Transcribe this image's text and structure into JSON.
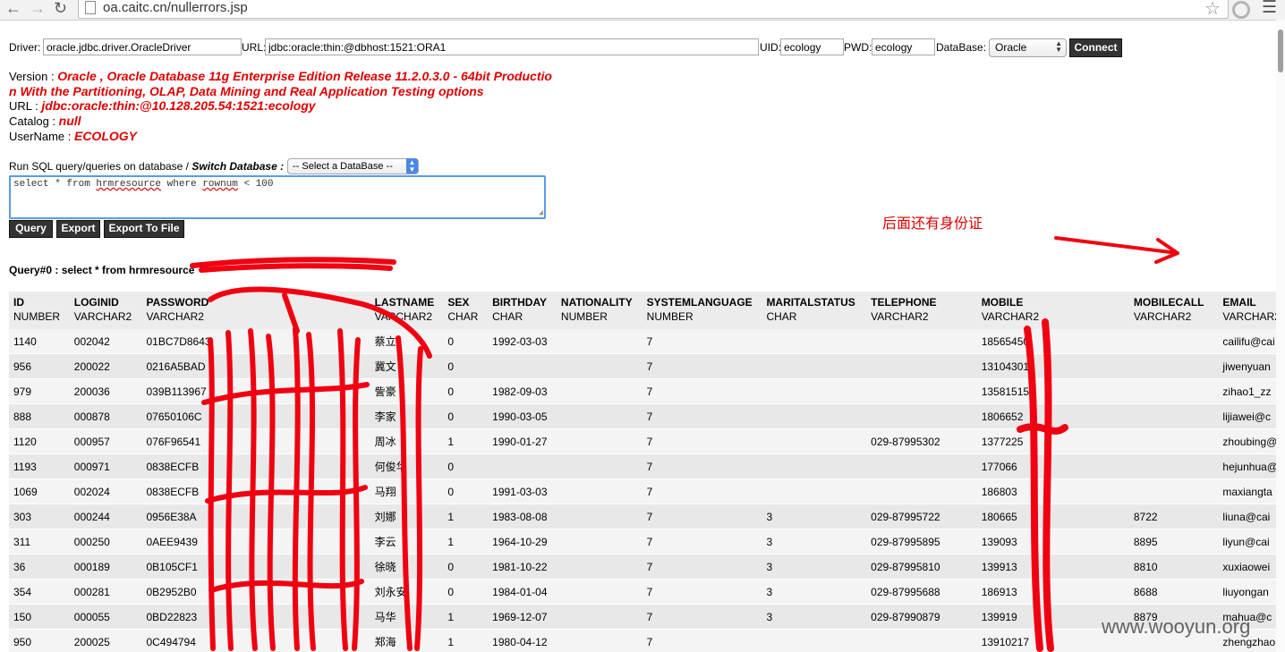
{
  "browser": {
    "url": "oa.caitc.cn/nullerrors.jsp"
  },
  "form": {
    "driver_label": "Driver:",
    "driver_value": "oracle.jdbc.driver.OracleDriver",
    "url_label": "URL:",
    "url_value": "jdbc:oracle:thin:@dbhost:1521:ORA1",
    "uid_label": "UID:",
    "uid_value": "ecology",
    "pwd_label": "PWD:",
    "pwd_value": "ecology",
    "database_label": "DataBase:",
    "database_value": "Oracle",
    "connect_label": "Connect"
  },
  "info": {
    "version_label": "Version :",
    "version_line1": "Oracle , Oracle Database 11g Enterprise Edition Release 11.2.0.3.0 - 64bit Productio",
    "version_line2": "n With the Partitioning, OLAP, Data Mining and Real Application Testing options",
    "url_label": "URL :",
    "url_value": "jdbc:oracle:thin:@10.128.205.54:1521:ecology",
    "catalog_label": "Catalog :",
    "catalog_value": "null",
    "username_label": "UserName :",
    "username_value": "ECOLOGY"
  },
  "query": {
    "run_label": "Run SQL query/queries on database /",
    "switch_label": "Switch Database :",
    "switch_value": "-- Select a DataBase --",
    "sql_before": "select * from ",
    "sql_table": "hrmresource",
    "sql_middle": " where ",
    "sql_rownum": "rownum",
    "sql_after": " < 100",
    "query_btn": "Query",
    "export_btn": "Export",
    "export_file_btn": "Export To File",
    "result_title": "Query#0 : select * from hrmresource"
  },
  "annotation": "后面还有身份证",
  "watermark": "www.wooyun.org",
  "table": {
    "columns": [
      {
        "name": "ID",
        "type": "NUMBER"
      },
      {
        "name": "LOGINID",
        "type": "VARCHAR2"
      },
      {
        "name": "PASSWORD",
        "type": "VARCHAR2"
      },
      {
        "name": "LASTNAME",
        "type": "VARCHAR2"
      },
      {
        "name": "SEX",
        "type": "CHAR"
      },
      {
        "name": "BIRTHDAY",
        "type": "CHAR"
      },
      {
        "name": "NATIONALITY",
        "type": "NUMBER"
      },
      {
        "name": "SYSTEMLANGUAGE",
        "type": "NUMBER"
      },
      {
        "name": "MARITALSTATUS",
        "type": "CHAR"
      },
      {
        "name": "TELEPHONE",
        "type": "VARCHAR2"
      },
      {
        "name": "MOBILE",
        "type": "VARCHAR2"
      },
      {
        "name": "MOBILECALL",
        "type": "VARCHAR2"
      },
      {
        "name": "EMAIL",
        "type": "VARCHAR2"
      }
    ],
    "rows": [
      [
        "1140",
        "002042",
        "01BC7D8643",
        "蔡立",
        "0",
        "1992-03-03",
        "",
        "7",
        "",
        "",
        "18565450",
        "",
        "cailifu@cai"
      ],
      [
        "956",
        "200022",
        "0216A5BAD",
        "冀文",
        "0",
        "",
        "",
        "7",
        "",
        "",
        "13104301",
        "",
        "jiwenyuan"
      ],
      [
        "979",
        "200036",
        "039B113967",
        "訾豪",
        "0",
        "1982-09-03",
        "",
        "7",
        "",
        "",
        "13581515",
        "",
        "zihao1_zz"
      ],
      [
        "888",
        "000878",
        "07650106C",
        "李家",
        "0",
        "1990-03-05",
        "",
        "7",
        "",
        "",
        "1806652",
        "",
        "lijiawei@c"
      ],
      [
        "1120",
        "000957",
        "076F96541",
        "周冰",
        "1",
        "1990-01-27",
        "",
        "7",
        "",
        "029-87995302",
        "1377225",
        "",
        "zhoubing@"
      ],
      [
        "1193",
        "000971",
        "0838ECFB",
        "何俊华",
        "0",
        "",
        "",
        "7",
        "",
        "",
        "177066",
        "",
        "hejunhua@"
      ],
      [
        "1069",
        "002024",
        "0838ECFB",
        "马翔",
        "0",
        "1991-03-03",
        "",
        "7",
        "",
        "",
        "186803",
        "",
        "maxiangta"
      ],
      [
        "303",
        "000244",
        "0956E38A",
        "刘娜",
        "1",
        "1983-08-08",
        "",
        "7",
        "3",
        "029-87995722",
        "180665",
        "8722",
        "liuna@cai"
      ],
      [
        "311",
        "000250",
        "0AEE9439",
        "李云",
        "1",
        "1964-10-29",
        "",
        "7",
        "3",
        "029-87995895",
        "139093",
        "8895",
        "liyun@cai"
      ],
      [
        "36",
        "000189",
        "0B105CF1",
        "徐晓",
        "0",
        "1981-10-22",
        "",
        "7",
        "3",
        "029-87995810",
        "139913",
        "8810",
        "xuxiaowei"
      ],
      [
        "354",
        "000281",
        "0B2952B0",
        "刘永安",
        "0",
        "1984-01-04",
        "",
        "7",
        "3",
        "029-87995688",
        "186913",
        "8688",
        "liuyongan"
      ],
      [
        "150",
        "000055",
        "0BD22823",
        "马华",
        "1",
        "1969-12-07",
        "",
        "7",
        "3",
        "029-87990879",
        "139919",
        "8879",
        "mahua@c"
      ],
      [
        "950",
        "200025",
        "0C494794",
        "郑海",
        "1",
        "1980-04-12",
        "",
        "7",
        "",
        "",
        "13910217",
        "",
        "zhengzhao"
      ]
    ]
  }
}
